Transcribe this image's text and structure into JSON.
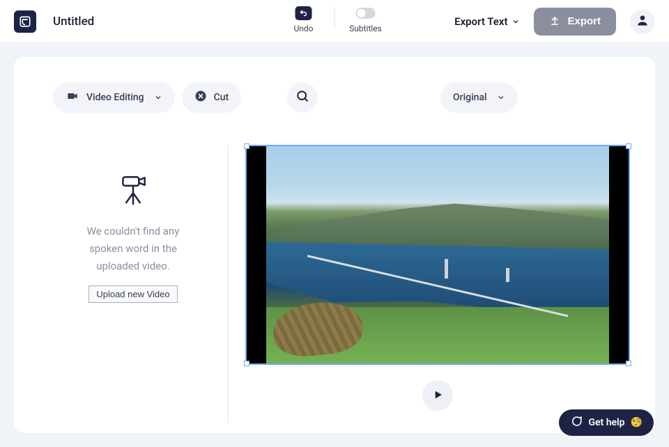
{
  "header": {
    "title": "Untitled",
    "undo_label": "Undo",
    "subtitles_label": "Subtitles",
    "export_text_label": "Export Text",
    "export_label": "Export"
  },
  "toolbar": {
    "video_editing_label": "Video Editing",
    "cut_label": "Cut",
    "original_label": "Original"
  },
  "empty": {
    "line1": "We couldn't find any",
    "line2": "spoken word in the",
    "line3": "uploaded video.",
    "upload_label": "Upload new Video"
  },
  "help": {
    "label": "Get help",
    "emoji": "🧐"
  }
}
